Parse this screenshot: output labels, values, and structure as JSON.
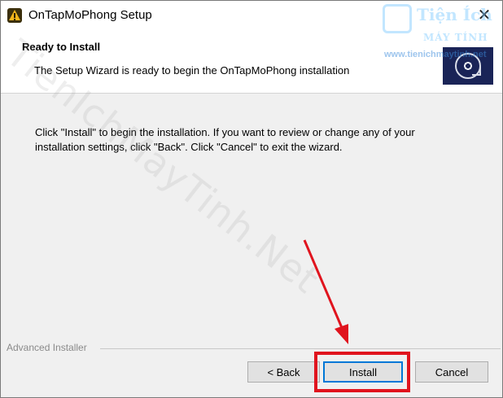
{
  "window": {
    "title": "OnTapMoPhong Setup",
    "close_glyph": "✕",
    "icon": "app-warning-icon"
  },
  "header": {
    "title": "Ready to Install",
    "subtitle": "The Setup Wizard is ready to begin the OnTapMoPhong installation",
    "image_icon": "install-disc-icon"
  },
  "main": {
    "message": "Click \"Install\" to begin the installation.  If you want to review or change any of your\ninstallation settings, click \"Back\".  Click \"Cancel\" to exit the wizard."
  },
  "footer": {
    "brand": "Advanced Installer",
    "back_label": "< Back",
    "install_label": "Install",
    "cancel_label": "Cancel"
  },
  "watermark": {
    "diagonal_text": "TienIchMayTinh.Net",
    "logo_line1": "Tiện Ích",
    "logo_line2": "MÁY TÍNH",
    "logo_url": "www.tienichmaytinh.net"
  },
  "colors": {
    "highlight": "#e0141e",
    "default_button_border": "#0078d7",
    "header_image_bg": "#1a2457"
  }
}
